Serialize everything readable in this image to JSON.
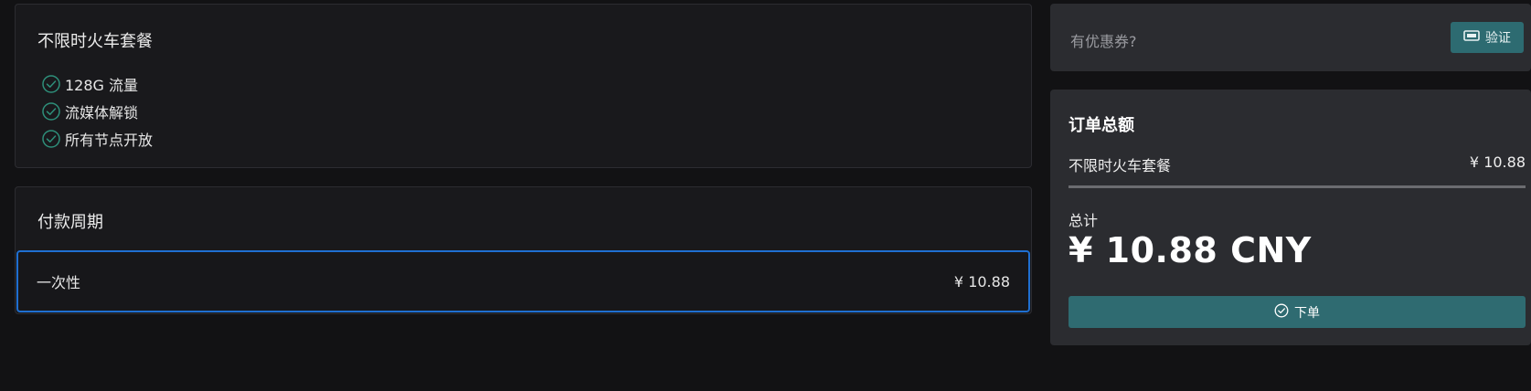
{
  "plan": {
    "title": "不限时火车套餐",
    "features": [
      "128G 流量",
      "流媒体解锁",
      "所有节点开放"
    ]
  },
  "billing_cycle": {
    "title": "付款周期",
    "option_label": "一次性",
    "option_price": "¥ 10.88"
  },
  "coupon": {
    "label": "有优惠券?",
    "verify_label": "验证",
    "icon": "ticket-icon"
  },
  "summary": {
    "title": "订单总额",
    "item_name": "不限时火车套餐",
    "item_price": "¥ 10.88",
    "total_label": "总计",
    "total_amount": "¥ 10.88 CNY",
    "order_label": "下单",
    "order_icon": "check-circle-icon"
  },
  "colors": {
    "accent": "#2d6b71",
    "selected_border": "#1f6fd1",
    "check_icon": "#2e8f7a"
  }
}
